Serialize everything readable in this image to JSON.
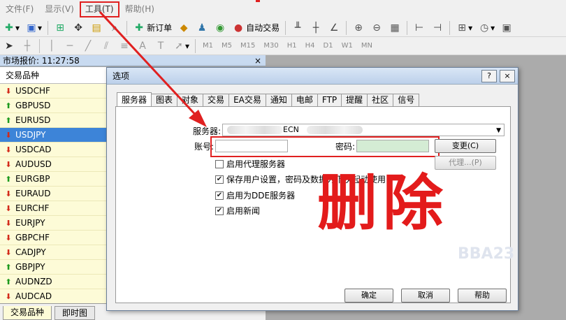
{
  "menu": {
    "file": "文件(F)",
    "view": "显示(V)",
    "tools": "工具(T)",
    "help": "帮助(H)"
  },
  "toolbar": {
    "new_order": "新订单",
    "auto_trade": "自动交易",
    "timeframes": [
      "M1",
      "M5",
      "M15",
      "M30",
      "H1",
      "H4",
      "D1",
      "W1",
      "MN"
    ]
  },
  "market_watch": {
    "title": "市场报价: 11:27:58",
    "close": "×",
    "column_header": "交易品种",
    "symbols": [
      {
        "name": "USDCHF",
        "dir": "down"
      },
      {
        "name": "GBPUSD",
        "dir": "up"
      },
      {
        "name": "EURUSD",
        "dir": "up"
      },
      {
        "name": "USDJPY",
        "dir": "down",
        "selected": true
      },
      {
        "name": "USDCAD",
        "dir": "down"
      },
      {
        "name": "AUDUSD",
        "dir": "down"
      },
      {
        "name": "EURGBP",
        "dir": "up"
      },
      {
        "name": "EURAUD",
        "dir": "down"
      },
      {
        "name": "EURCHF",
        "dir": "down"
      },
      {
        "name": "EURJPY",
        "dir": "down"
      },
      {
        "name": "GBPCHF",
        "dir": "down"
      },
      {
        "name": "CADJPY",
        "dir": "down"
      },
      {
        "name": "GBPJPY",
        "dir": "up"
      },
      {
        "name": "AUDNZD",
        "dir": "up"
      },
      {
        "name": "AUDCAD",
        "dir": "down"
      }
    ],
    "tabs": [
      "交易品种",
      "即时图"
    ]
  },
  "dialog": {
    "title": "选项",
    "help_btn": "?",
    "close_btn": "×",
    "tabs": [
      "服务器",
      "图表",
      "对象",
      "交易",
      "EA交易",
      "通知",
      "电邮",
      "FTP",
      "提醒",
      "社区",
      "信号"
    ],
    "server_label": "服务器:",
    "server_value_fragment": "ECN",
    "account_label": "账号:",
    "account_value": "",
    "password_label": "密码:",
    "password_value": "",
    "change_btn": "变更(C)",
    "proxy_btn": "代理...(P)",
    "checkboxes": [
      {
        "label": "启用代理服务器",
        "checked": false
      },
      {
        "label": "保存用户设置，密码及数据为下次起动使用",
        "checked": true
      },
      {
        "label": "启用为DDE服务器",
        "checked": true
      },
      {
        "label": "启用新闻",
        "checked": true
      }
    ],
    "ok_btn": "确定",
    "cancel_btn": "取消",
    "help_footer_btn": "帮助"
  },
  "annotation": {
    "delete_text": "删除",
    "color": "#e02020"
  },
  "watermark": "BBA23"
}
